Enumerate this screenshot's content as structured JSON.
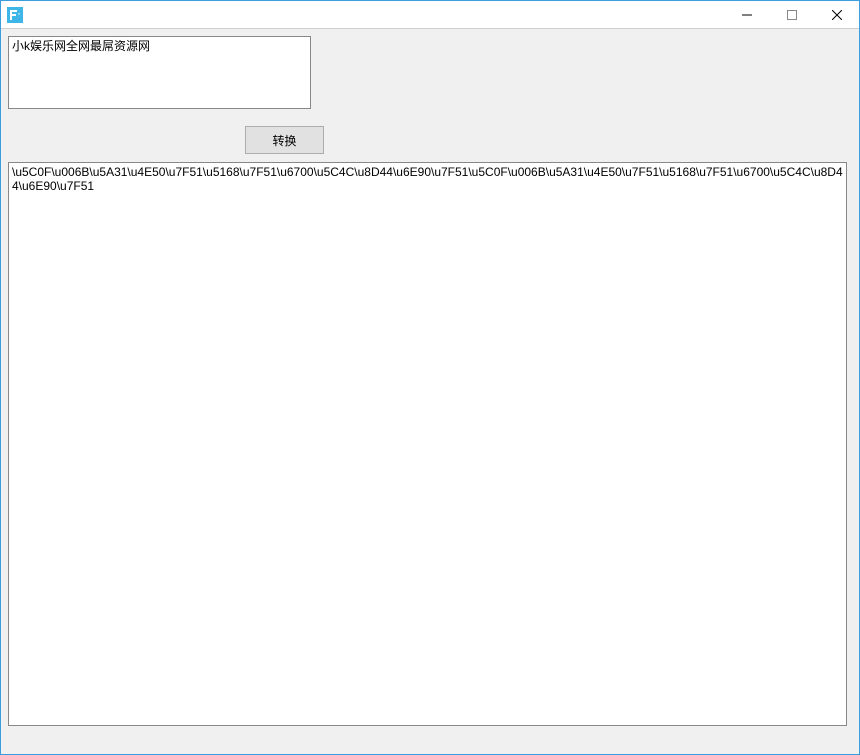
{
  "window": {
    "title": ""
  },
  "input": {
    "value": "小k娱乐网全网最屌资源网"
  },
  "buttons": {
    "convert": "转换"
  },
  "output": {
    "value": "\\u5C0F\\u006B\\u5A31\\u4E50\\u7F51\\u5168\\u7F51\\u6700\\u5C4C\\u8D44\\u6E90\\u7F51\\u5C0F\\u006B\\u5A31\\u4E50\\u7F51\\u5168\\u7F51\\u6700\\u5C4C\\u8D44\\u6E90\\u7F51"
  },
  "controls": {
    "minimize": "minimize",
    "maximize": "maximize",
    "close": "close"
  }
}
